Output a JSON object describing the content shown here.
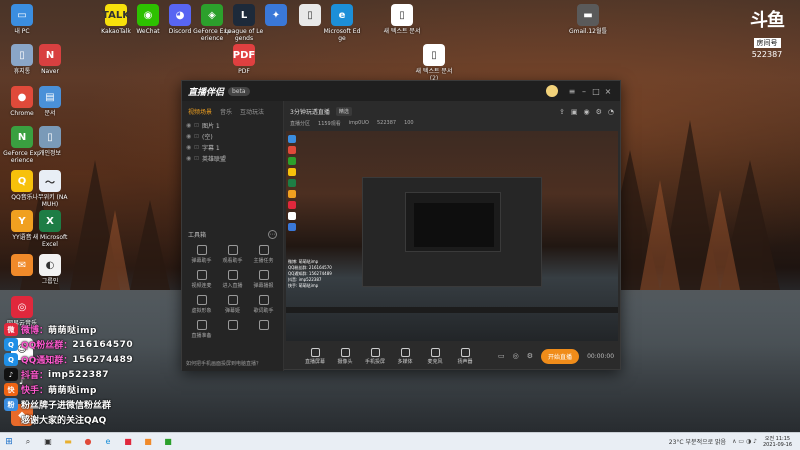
{
  "desktop": {
    "icons": [
      {
        "label": "내 PC",
        "color": "#3b8ee0",
        "glyph": "▭"
      },
      {
        "label": "KakaoTalk",
        "color": "#f7e00b",
        "glyph": "TALK"
      },
      {
        "label": "WeChat",
        "color": "#2dc100",
        "glyph": "◉"
      },
      {
        "label": "Discord",
        "color": "#5865f2",
        "glyph": "◕"
      },
      {
        "label": "GeForce Experience",
        "color": "#2ca02c",
        "glyph": "◈"
      },
      {
        "label": "League of Legends",
        "color": "#1d2a3a",
        "glyph": "L"
      },
      {
        "label": "",
        "color": "#3a78d8",
        "glyph": "✦"
      },
      {
        "label": "",
        "color": "#e8e8e8",
        "glyph": "▯"
      },
      {
        "label": "Microsoft Edge",
        "color": "#1c8fd8",
        "glyph": "e"
      },
      {
        "label": "새 텍스트 문서",
        "color": "#ffffff",
        "glyph": "▯"
      },
      {
        "label": "Gmail.12월틀",
        "color": "#5a5a5a",
        "glyph": "▬"
      },
      {
        "label": "휴지통",
        "color": "#8aa6c8",
        "glyph": "▯"
      },
      {
        "label": "Naver",
        "color": "#d84040",
        "glyph": "N"
      },
      {
        "label": "PDF",
        "color": "#e04040",
        "glyph": "PDF"
      },
      {
        "label": "새 텍스트 문서 (2)",
        "color": "#ffffff",
        "glyph": "▯"
      },
      {
        "label": "Chrome",
        "color": "#e04a3a",
        "glyph": "●"
      },
      {
        "label": "문서",
        "color": "#4a90d8",
        "glyph": "▤"
      },
      {
        "label": "GeForce Experience",
        "color": "#3aa040",
        "glyph": "N"
      },
      {
        "label": "개인정보",
        "color": "#7a9ab8",
        "glyph": "▯"
      },
      {
        "label": "QQ音乐",
        "color": "#f7c10b",
        "glyph": "Q"
      },
      {
        "label": "나무위키 (NAMUH)",
        "color": "#e8eef5",
        "glyph": "〜"
      },
      {
        "label": "YY语音",
        "color": "#f0a020",
        "glyph": "Y"
      },
      {
        "label": "새 Microsoft Excel",
        "color": "#1e7d45",
        "glyph": "X"
      },
      {
        "label": "",
        "color": "#f08a2a",
        "glyph": "✉"
      },
      {
        "label": "그룹인",
        "color": "#f2f2f2",
        "glyph": "◐"
      },
      {
        "label": "网易云音乐",
        "color": "#e0283c",
        "glyph": "◎"
      },
      {
        "label": "",
        "color": "#ffffff",
        "glyph": "☺"
      },
      {
        "label": "",
        "color": "#444444",
        "glyph": "♪"
      },
      {
        "label": "",
        "color": "#e86a2a",
        "glyph": "◆"
      }
    ]
  },
  "streamer_badge": {
    "mark": "斗鱼",
    "sub": "房间号",
    "number": "522387"
  },
  "app": {
    "logo": "直播伴侣",
    "version": "beta",
    "left_tabs": [
      "视频场景",
      "音乐",
      "互动玩法"
    ],
    "scenes": [
      {
        "label": "图片 1"
      },
      {
        "label": "(空)"
      },
      {
        "label": "字幕 1"
      },
      {
        "label": "英雄联盟"
      }
    ],
    "tools_title": "工具箱",
    "tools": [
      {
        "label": "弹幕助手"
      },
      {
        "label": "观看助手"
      },
      {
        "label": "主播任务"
      },
      {
        "label": "视频连麦"
      },
      {
        "label": "进入直播"
      },
      {
        "label": "弹幕播报"
      },
      {
        "label": "虚拟形象"
      },
      {
        "label": "弹幕姬"
      },
      {
        "label": "歌词助手"
      },
      {
        "label": "直播准备"
      },
      {
        "label": "",
        "glyph": "▭"
      },
      {
        "label": "",
        "glyph": "◬"
      }
    ],
    "footer_note": "如何把手机画面投屏到电脑直播？",
    "room_title": "3分钟玩透直播",
    "room_tag": "精选",
    "info": [
      "直播分区",
      "1159观看",
      "imp0UO",
      "522387",
      "100"
    ],
    "preview_overlay_lines": [
      "微博: 萌萌哒imp",
      "QQ粉丝群: 216164570",
      "QQ通知群: 156274489",
      "抖音: imp522387",
      "快手: 萌萌哒imp"
    ],
    "bottom_buttons": [
      "直播屏幕",
      "摄像头",
      "手机投屏",
      "多媒体",
      "麦克风",
      "扬声器"
    ],
    "start_button": "开始直播",
    "timer": "00:00:00"
  },
  "overlay": {
    "lines": [
      {
        "icon": "weibo",
        "icon_color": "#e0283c",
        "icon_glyph": "微",
        "label": "微博：",
        "value": "萌萌哒imp"
      },
      {
        "icon": "qq",
        "icon_color": "#1f8fe6",
        "icon_glyph": "Q",
        "label": "QQ粉丝群：",
        "value": "216164570"
      },
      {
        "icon": "qq2",
        "icon_color": "#1f8fe6",
        "icon_glyph": "Q",
        "label": "QQ通知群：",
        "value": "156274489"
      },
      {
        "icon": "douyin",
        "icon_color": "#111111",
        "icon_glyph": "♪",
        "label": "抖音：",
        "value": "imp522387"
      },
      {
        "icon": "kuaishou",
        "icon_color": "#f06414",
        "icon_glyph": "快",
        "label": "快手：",
        "value": "萌萌哒imp"
      }
    ],
    "line6": "粉丝牌子进微信粉丝群",
    "line7": "感谢大家的关注QAQ",
    "line6_icon": "粉"
  },
  "taskbar": {
    "start_icon": "⊞",
    "apps": [
      {
        "name": "search",
        "glyph": "⌕",
        "color": "#333333",
        "bg": "transparent"
      },
      {
        "name": "task-view",
        "glyph": "▣",
        "color": "#333333",
        "bg": "transparent"
      },
      {
        "name": "file-explorer",
        "glyph": "▬",
        "color": "#e8b030",
        "bg": "transparent"
      },
      {
        "name": "chrome",
        "glyph": "●",
        "color": "#e04a3a",
        "bg": "transparent"
      },
      {
        "name": "edge",
        "glyph": "e",
        "color": "#1c8fd8",
        "bg": "transparent"
      },
      {
        "name": "app-red",
        "glyph": "■",
        "color": "#e0283c",
        "bg": "transparent"
      },
      {
        "name": "app-orange",
        "glyph": "■",
        "color": "#f08a2a",
        "bg": "transparent"
      },
      {
        "name": "app-green",
        "glyph": "■",
        "color": "#2ca02c",
        "bg": "transparent"
      }
    ],
    "weather": "23°C 부분적으로 맑음",
    "clock_time": "오전 11:15",
    "clock_date": "2021-09-16"
  }
}
